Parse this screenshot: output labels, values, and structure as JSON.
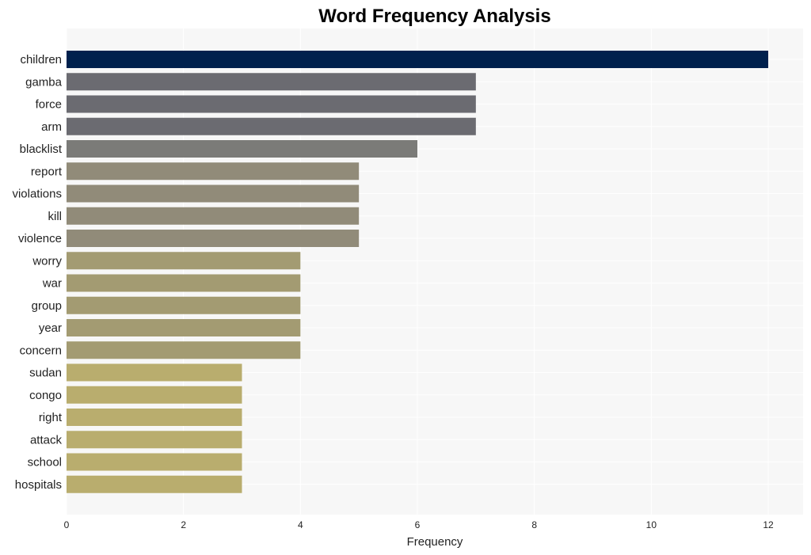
{
  "chart_data": {
    "type": "bar",
    "orientation": "horizontal",
    "title": "Word Frequency Analysis",
    "xlabel": "Frequency",
    "ylabel": "",
    "xlim": [
      0,
      12.6
    ],
    "xticks": [
      0,
      2,
      4,
      6,
      8,
      10,
      12
    ],
    "grid": true,
    "categories": [
      "children",
      "gamba",
      "force",
      "arm",
      "blacklist",
      "report",
      "violations",
      "kill",
      "violence",
      "worry",
      "war",
      "group",
      "year",
      "concern",
      "sudan",
      "congo",
      "right",
      "attack",
      "school",
      "hospitals"
    ],
    "values": [
      12,
      7,
      7,
      7,
      6,
      5,
      5,
      5,
      5,
      4,
      4,
      4,
      4,
      4,
      3,
      3,
      3,
      3,
      3,
      3
    ],
    "colors_by_value": {
      "12": "#00214d",
      "7": "#6b6b71",
      "6": "#7b7b78",
      "5": "#918b79",
      "4": "#a39b72",
      "3": "#b9ad6e"
    },
    "plot_background": "#f7f7f7"
  }
}
